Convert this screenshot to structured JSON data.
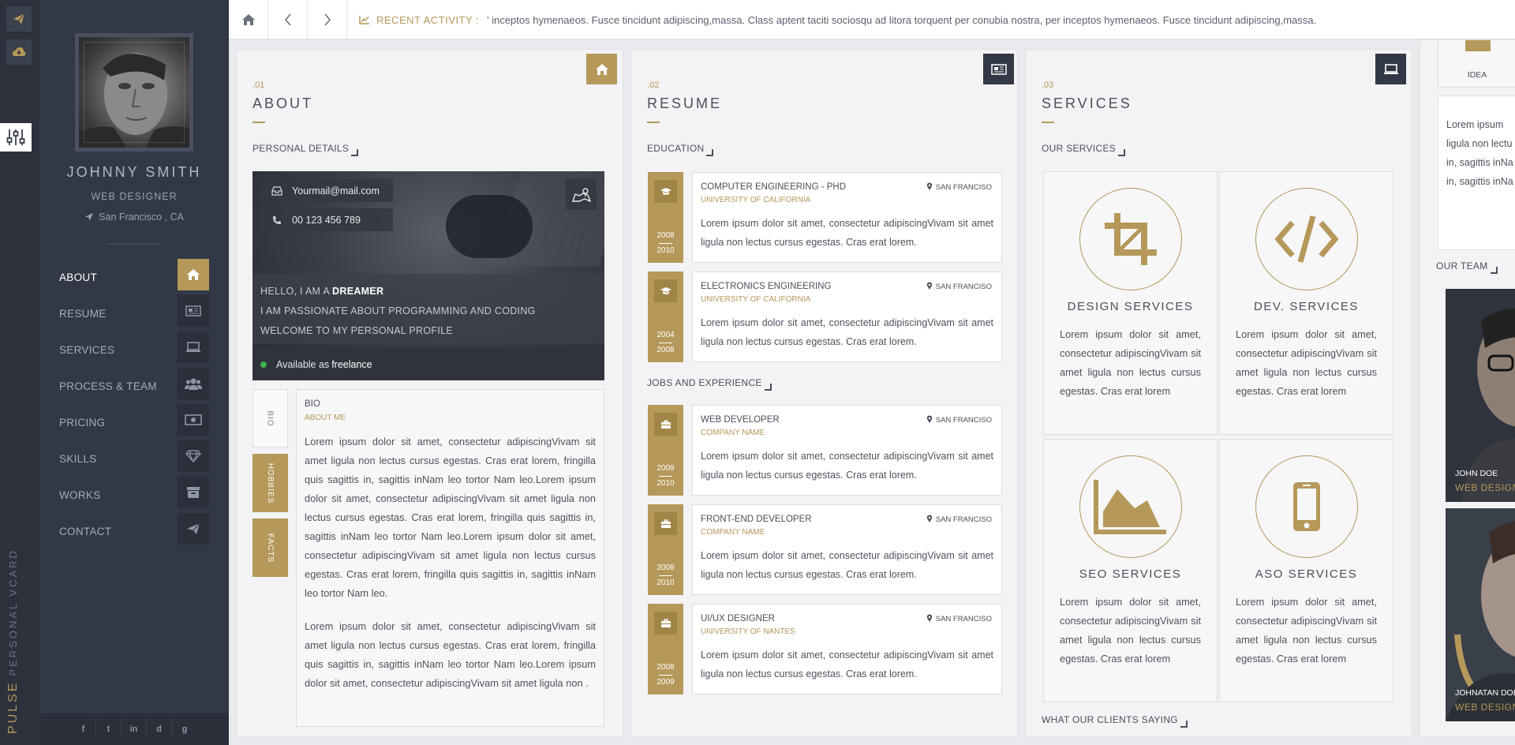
{
  "brand": {
    "name": "PULSE",
    "sub": "PERSONAL VCARD"
  },
  "profile": {
    "name": "JOHNNY SMITH",
    "job": "WEB DESIGNER",
    "location": "San Francisco , CA"
  },
  "nav": [
    {
      "label": "ABOUT",
      "icon": "home-icon",
      "active": true
    },
    {
      "label": "RESUME",
      "icon": "newspaper-icon"
    },
    {
      "label": "SERVICES",
      "icon": "laptop-icon"
    },
    {
      "label": "PROCESS & TEAM",
      "icon": "users-icon"
    },
    {
      "label": "PRICING",
      "icon": "money-icon"
    },
    {
      "label": "SKILLS",
      "icon": "diamond-icon"
    },
    {
      "label": "WORKS",
      "icon": "archive-icon"
    },
    {
      "label": "CONTACT",
      "icon": "paper-plane-icon"
    }
  ],
  "socials": [
    "f",
    "t",
    "in",
    "d",
    "g"
  ],
  "topbar": {
    "label": "RECENT ACTIVITY :",
    "text": "' inceptos hymenaeos. Fusce tincidunt adipiscing,massa. Class aptent taciti sociosqu ad litora torquent per conubia nostra, per inceptos hymenaeos. Fusce tincidunt adipiscing,massa."
  },
  "about": {
    "num": ".01",
    "title": "ABOUT",
    "section": "PERSONAL DETAILS",
    "email": "Yourmail@mail.com",
    "phone": "00 123 456 789",
    "intro_pre": "HELLO, I AM A ",
    "intro_bold": "DREAMER",
    "intro2": "I AM PASSIONATE ABOUT PROGRAMMING AND CODING",
    "intro3": "WELCOME TO MY PERSONAL PROFILE",
    "avail_pre": "Available as ",
    "avail_bold": "freelance",
    "tabs": [
      "BIO",
      "HOBBIES",
      "FACTS"
    ],
    "bio_title": "BIO",
    "bio_sub": "ABOUT ME",
    "bio_p1": "Lorem ipsum dolor sit amet, consectetur adipiscingVivam sit amet ligula non lectus cursus egestas. Cras erat lorem, fringilla quis sagittis in, sagittis inNam leo tortor Nam leo.Lorem ipsum dolor sit amet, consectetur adipiscingVivam sit amet ligula non lectus cursus egestas. Cras erat lorem, fringilla quis sagittis in, sagittis inNam leo tortor Nam leo.Lorem ipsum dolor sit amet, consectetur adipiscingVivam sit amet ligula non lectus cursus egestas. Cras erat lorem, fringilla quis sagittis in, sagittis inNam leo tortor Nam leo.",
    "bio_p2": "Lorem ipsum dolor sit amet, consectetur adipiscingVivam sit amet ligula non lectus cursus egestas. Cras erat lorem, fringilla quis sagittis in, sagittis inNam leo tortor Nam leo.Lorem ipsum dolor sit amet, consectetur adipiscingVivam sit amet ligula non ."
  },
  "resume": {
    "num": ".02",
    "title": "RESUME",
    "edu_title": "EDUCATION",
    "jobs_title": "JOBS AND EXPERIENCE",
    "lorem": "Lorem ipsum dolor sit amet, consectetur adipiscingVivam sit amet ligula non lectus cursus egestas. Cras erat lorem.",
    "education": [
      {
        "title": "COMPUTER ENGINEERING - PHD",
        "org": "UNIVERSITY OF CALIFORNIA",
        "place": "SAN FRANCISO",
        "from": "2008",
        "to": "2010"
      },
      {
        "title": "ELECTRONICS ENGINEERING",
        "org": "UNIVERSITY OF CALIFORNIA",
        "place": "SAN FRANCISO",
        "from": "2004",
        "to": "2008"
      }
    ],
    "jobs": [
      {
        "title": "WEB DEVELOPER",
        "org": "COMPANY NAME",
        "place": "SAN FRANCISO",
        "from": "2009",
        "to": "2010"
      },
      {
        "title": "FRONT-END DEVELOPER",
        "org": "COMPANY NAME",
        "place": "SAN FRANCISO",
        "from": "2009",
        "to": "2010"
      },
      {
        "title": "UI/UX DESIGNER",
        "org": "UNIVERSITY OF NANTES",
        "place": "SAN FRANCISO",
        "from": "2008",
        "to": "2009"
      }
    ]
  },
  "services": {
    "num": ".03",
    "title": "SERVICES",
    "section": "OUR SERVICES",
    "clients": "WHAT OUR CLIENTS SAYING",
    "lorem": "Lorem ipsum dolor sit amet, consectetur adipiscingVivam sit amet ligula non lectus cursus egestas. Cras erat lorem",
    "items": [
      {
        "title": "DESIGN SERVICES",
        "icon": "crop-icon"
      },
      {
        "title": "DEV. SERVICES",
        "icon": "code-icon"
      },
      {
        "title": "SEO SERVICES",
        "icon": "area-chart-icon"
      },
      {
        "title": "ASO SERVICES",
        "icon": "mobile-icon"
      }
    ]
  },
  "process": {
    "idea": "IDEA",
    "lorem_lines": [
      "Lorem ipsum",
      "ligula non lectu",
      "in, sagittis inNa",
      "in, sagittis inNa"
    ],
    "team_title": "OUR TEAM",
    "members": [
      {
        "name": "JOHN DOE",
        "role": "WEB DESIGNER"
      },
      {
        "name": "JOHNATAN DOE",
        "role": "WEB DESIGNER"
      }
    ]
  }
}
